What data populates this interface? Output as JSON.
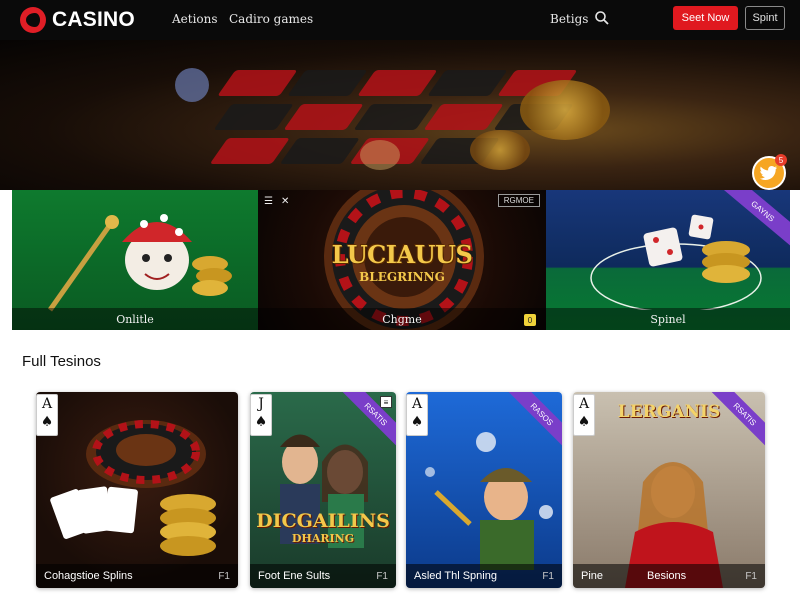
{
  "header": {
    "logo_text": "CASINO",
    "nav": [
      "Aetions",
      "Cadiro games"
    ],
    "right_link": "Betigs",
    "primary_button": "Seet Now",
    "secondary_button": "Spint",
    "colors": {
      "bar": "#0a0a0a",
      "accent": "#e0191f"
    }
  },
  "hero": {
    "badge_count": "5",
    "badge_icon": "twitter-bird-icon"
  },
  "featured": [
    {
      "caption": "Onlitle"
    },
    {
      "title": "LUCIAUUS",
      "subtitle": "BLEGRINNG",
      "caption": "Chgme",
      "tag": "RGMOE",
      "coin_label": "0"
    },
    {
      "caption": "Spinel",
      "ribbon": "GAYNS"
    }
  ],
  "section": {
    "title": "Full Tesinos"
  },
  "cards": [
    {
      "rank": "A",
      "suit": "♠",
      "name": "Cohagstioe Splins",
      "code": "F1"
    },
    {
      "rank": "J",
      "suit": "♠",
      "title": "DICGAILINS",
      "subtitle": "DHARING",
      "ribbon": "RSATIS",
      "name": "Foot Ene Sults",
      "code": "F1"
    },
    {
      "rank": "A",
      "suit": "♠",
      "ribbon": "RASOS",
      "name": "Asled Thl Spning",
      "code": "F1"
    },
    {
      "rank": "A",
      "suit": "♠",
      "title": "LERGANIS",
      "ribbon": "RSATIS",
      "name": "Pine",
      "name2": "Besions",
      "code": "F1"
    }
  ]
}
